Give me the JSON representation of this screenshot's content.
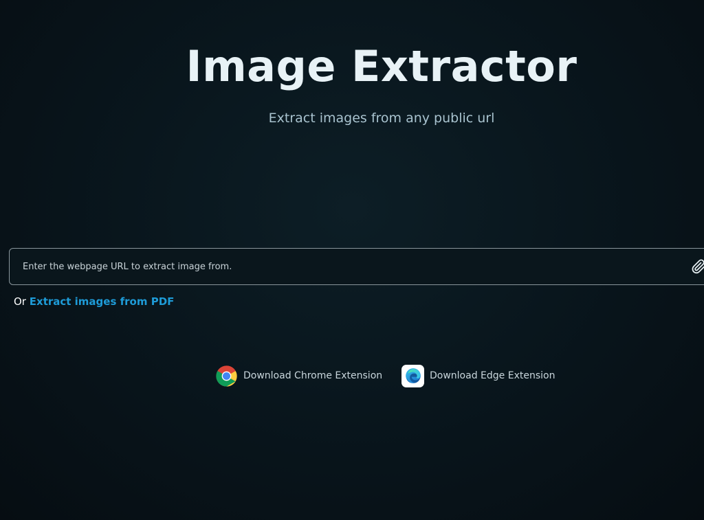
{
  "header": {
    "title": "Image Extractor",
    "subtitle": "Extract images from any public url"
  },
  "url_input": {
    "placeholder": "Enter the webpage URL to extract image from.",
    "value": "",
    "icon": "paperclip-icon"
  },
  "alt_option": {
    "prefix": "Or",
    "link_label": "Extract images from PDF"
  },
  "extensions": [
    {
      "label": "Download Chrome Extension",
      "icon": "chrome-icon"
    },
    {
      "label": "Download Edge Extension",
      "icon": "edge-icon"
    }
  ],
  "colors": {
    "background": "#09161d",
    "accent_link": "#1e9bd7",
    "title": "#e8f2f6",
    "subtitle": "#a9c3cf"
  }
}
